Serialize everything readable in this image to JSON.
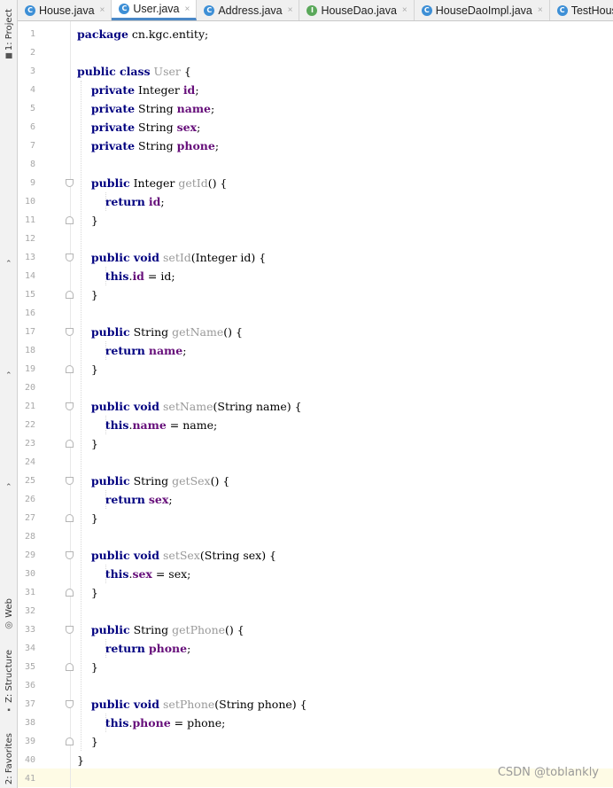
{
  "sidebar": {
    "project_label": "1: Project",
    "web_label": "Web",
    "structure_label": "Z: Structure",
    "favorites_label": "2: Favorites"
  },
  "tabs": [
    {
      "label": "House.java",
      "icon": "class-icon",
      "color": "#3d8fd6",
      "active": false
    },
    {
      "label": "User.java",
      "icon": "class-icon",
      "color": "#3d8fd6",
      "active": true
    },
    {
      "label": "Address.java",
      "icon": "class-icon",
      "color": "#3d8fd6",
      "active": false
    },
    {
      "label": "HouseDao.java",
      "icon": "interface-icon",
      "color": "#5aa85a",
      "active": false
    },
    {
      "label": "HouseDaoImpl.java",
      "icon": "class-icon",
      "color": "#3d8fd6",
      "active": false
    },
    {
      "label": "TestHous",
      "icon": "class-icon",
      "color": "#3d8fd6",
      "active": false
    }
  ],
  "editor": {
    "current_line": "41",
    "lines": [
      [
        {
          "t": "kw",
          "v": "package"
        },
        {
          "t": "p",
          "v": " cn.kgc.entity;"
        }
      ],
      [],
      [
        {
          "t": "kw",
          "v": "public class"
        },
        {
          "t": "p",
          "v": " "
        },
        {
          "t": "mth",
          "v": "User"
        },
        {
          "t": "p",
          "v": " {"
        }
      ],
      [
        {
          "t": "p",
          "v": "    "
        },
        {
          "t": "kw",
          "v": "private"
        },
        {
          "t": "p",
          "v": " Integer "
        },
        {
          "t": "fld",
          "v": "id"
        },
        {
          "t": "p",
          "v": ";"
        }
      ],
      [
        {
          "t": "p",
          "v": "    "
        },
        {
          "t": "kw",
          "v": "private"
        },
        {
          "t": "p",
          "v": " String "
        },
        {
          "t": "fld",
          "v": "name"
        },
        {
          "t": "p",
          "v": ";"
        }
      ],
      [
        {
          "t": "p",
          "v": "    "
        },
        {
          "t": "kw",
          "v": "private"
        },
        {
          "t": "p",
          "v": " String "
        },
        {
          "t": "fld",
          "v": "sex"
        },
        {
          "t": "p",
          "v": ";"
        }
      ],
      [
        {
          "t": "p",
          "v": "    "
        },
        {
          "t": "kw",
          "v": "private"
        },
        {
          "t": "p",
          "v": " String "
        },
        {
          "t": "fld",
          "v": "phone"
        },
        {
          "t": "p",
          "v": ";"
        }
      ],
      [],
      [
        {
          "t": "p",
          "v": "    "
        },
        {
          "t": "kw",
          "v": "public"
        },
        {
          "t": "p",
          "v": " Integer "
        },
        {
          "t": "mth",
          "v": "getId"
        },
        {
          "t": "p",
          "v": "() {"
        }
      ],
      [
        {
          "t": "p",
          "v": "        "
        },
        {
          "t": "kw",
          "v": "return"
        },
        {
          "t": "p",
          "v": " "
        },
        {
          "t": "fld",
          "v": "id"
        },
        {
          "t": "p",
          "v": ";"
        }
      ],
      [
        {
          "t": "p",
          "v": "    }"
        }
      ],
      [],
      [
        {
          "t": "p",
          "v": "    "
        },
        {
          "t": "kw",
          "v": "public void"
        },
        {
          "t": "p",
          "v": " "
        },
        {
          "t": "mth",
          "v": "setId"
        },
        {
          "t": "p",
          "v": "(Integer id) {"
        }
      ],
      [
        {
          "t": "p",
          "v": "        "
        },
        {
          "t": "kw",
          "v": "this"
        },
        {
          "t": "p",
          "v": "."
        },
        {
          "t": "fld",
          "v": "id"
        },
        {
          "t": "p",
          "v": " = id;"
        }
      ],
      [
        {
          "t": "p",
          "v": "    }"
        }
      ],
      [],
      [
        {
          "t": "p",
          "v": "    "
        },
        {
          "t": "kw",
          "v": "public"
        },
        {
          "t": "p",
          "v": " String "
        },
        {
          "t": "mth",
          "v": "getName"
        },
        {
          "t": "p",
          "v": "() {"
        }
      ],
      [
        {
          "t": "p",
          "v": "        "
        },
        {
          "t": "kw",
          "v": "return"
        },
        {
          "t": "p",
          "v": " "
        },
        {
          "t": "fld",
          "v": "name"
        },
        {
          "t": "p",
          "v": ";"
        }
      ],
      [
        {
          "t": "p",
          "v": "    }"
        }
      ],
      [],
      [
        {
          "t": "p",
          "v": "    "
        },
        {
          "t": "kw",
          "v": "public void"
        },
        {
          "t": "p",
          "v": " "
        },
        {
          "t": "mth",
          "v": "setName"
        },
        {
          "t": "p",
          "v": "(String name) {"
        }
      ],
      [
        {
          "t": "p",
          "v": "        "
        },
        {
          "t": "kw",
          "v": "this"
        },
        {
          "t": "p",
          "v": "."
        },
        {
          "t": "fld",
          "v": "name"
        },
        {
          "t": "p",
          "v": " = name;"
        }
      ],
      [
        {
          "t": "p",
          "v": "    }"
        }
      ],
      [],
      [
        {
          "t": "p",
          "v": "    "
        },
        {
          "t": "kw",
          "v": "public"
        },
        {
          "t": "p",
          "v": " String "
        },
        {
          "t": "mth",
          "v": "getSex"
        },
        {
          "t": "p",
          "v": "() {"
        }
      ],
      [
        {
          "t": "p",
          "v": "        "
        },
        {
          "t": "kw",
          "v": "return"
        },
        {
          "t": "p",
          "v": " "
        },
        {
          "t": "fld",
          "v": "sex"
        },
        {
          "t": "p",
          "v": ";"
        }
      ],
      [
        {
          "t": "p",
          "v": "    }"
        }
      ],
      [],
      [
        {
          "t": "p",
          "v": "    "
        },
        {
          "t": "kw",
          "v": "public void"
        },
        {
          "t": "p",
          "v": " "
        },
        {
          "t": "mth",
          "v": "setSex"
        },
        {
          "t": "p",
          "v": "(String sex) {"
        }
      ],
      [
        {
          "t": "p",
          "v": "        "
        },
        {
          "t": "kw",
          "v": "this"
        },
        {
          "t": "p",
          "v": "."
        },
        {
          "t": "fld",
          "v": "sex"
        },
        {
          "t": "p",
          "v": " = sex;"
        }
      ],
      [
        {
          "t": "p",
          "v": "    }"
        }
      ],
      [],
      [
        {
          "t": "p",
          "v": "    "
        },
        {
          "t": "kw",
          "v": "public"
        },
        {
          "t": "p",
          "v": " String "
        },
        {
          "t": "mth",
          "v": "getPhone"
        },
        {
          "t": "p",
          "v": "() {"
        }
      ],
      [
        {
          "t": "p",
          "v": "        "
        },
        {
          "t": "kw",
          "v": "return"
        },
        {
          "t": "p",
          "v": " "
        },
        {
          "t": "fld",
          "v": "phone"
        },
        {
          "t": "p",
          "v": ";"
        }
      ],
      [
        {
          "t": "p",
          "v": "    }"
        }
      ],
      [],
      [
        {
          "t": "p",
          "v": "    "
        },
        {
          "t": "kw",
          "v": "public void"
        },
        {
          "t": "p",
          "v": " "
        },
        {
          "t": "mth",
          "v": "setPhone"
        },
        {
          "t": "p",
          "v": "(String phone) {"
        }
      ],
      [
        {
          "t": "p",
          "v": "        "
        },
        {
          "t": "kw",
          "v": "this"
        },
        {
          "t": "p",
          "v": "."
        },
        {
          "t": "fld",
          "v": "phone"
        },
        {
          "t": "p",
          "v": " = phone;"
        }
      ],
      [
        {
          "t": "p",
          "v": "    }"
        }
      ],
      [
        {
          "t": "p",
          "v": "}"
        }
      ],
      []
    ]
  },
  "watermark": "CSDN @toblankly"
}
